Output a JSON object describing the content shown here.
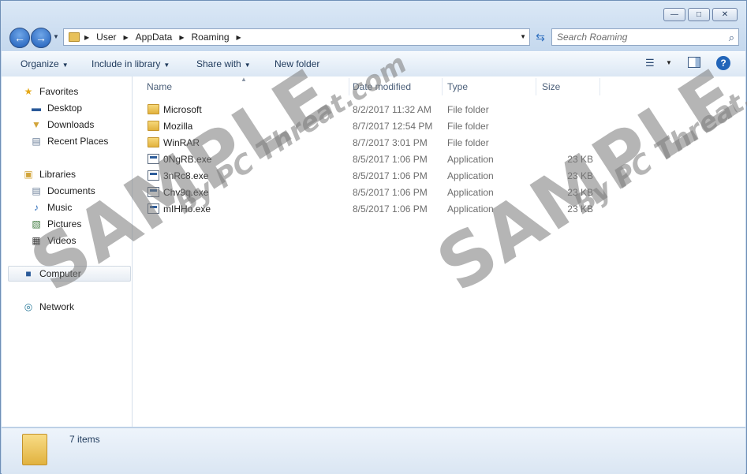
{
  "window": {
    "caption_buttons": [
      "minimize-icon",
      "maximize-icon",
      "close-icon"
    ]
  },
  "nav": {
    "address": [
      "User",
      "AppData",
      "Roaming"
    ],
    "search_placeholder": "Search Roaming"
  },
  "toolbar": {
    "organize": "Organize",
    "include": "Include in library",
    "share": "Share with",
    "new_folder": "New folder"
  },
  "sidebar": {
    "favorites": "Favorites",
    "desktop": "Desktop",
    "downloads": "Downloads",
    "recent": "Recent Places",
    "libraries": "Libraries",
    "documents": "Documents",
    "music": "Music",
    "pictures": "Pictures",
    "videos": "Videos",
    "computer": "Computer",
    "network": "Network"
  },
  "columns": {
    "name": "Name",
    "date": "Date modified",
    "type": "Type",
    "size": "Size"
  },
  "files": [
    {
      "name": "Microsoft",
      "date": "8/2/2017 11:32 AM",
      "type": "File folder",
      "size": "",
      "kind": "folder"
    },
    {
      "name": "Mozilla",
      "date": "8/7/2017 12:54 PM",
      "type": "File folder",
      "size": "",
      "kind": "folder"
    },
    {
      "name": "WinRAR",
      "date": "8/7/2017 3:01 PM",
      "type": "File folder",
      "size": "",
      "kind": "folder"
    },
    {
      "name": "0NgRB.exe",
      "date": "8/5/2017 1:06 PM",
      "type": "Application",
      "size": "23 KB",
      "kind": "exe"
    },
    {
      "name": "3nRc8.exe",
      "date": "8/5/2017 1:06 PM",
      "type": "Application",
      "size": "23 KB",
      "kind": "exe"
    },
    {
      "name": "Chv9q.exe",
      "date": "8/5/2017 1:06 PM",
      "type": "Application",
      "size": "23 KB",
      "kind": "exe"
    },
    {
      "name": "mIHHo.exe",
      "date": "8/5/2017 1:06 PM",
      "type": "Application",
      "size": "23 KB",
      "kind": "exe"
    }
  ],
  "status": {
    "count": "7 items"
  },
  "watermark": {
    "big": "SAMPLE",
    "small": "By PC Threat.com"
  }
}
